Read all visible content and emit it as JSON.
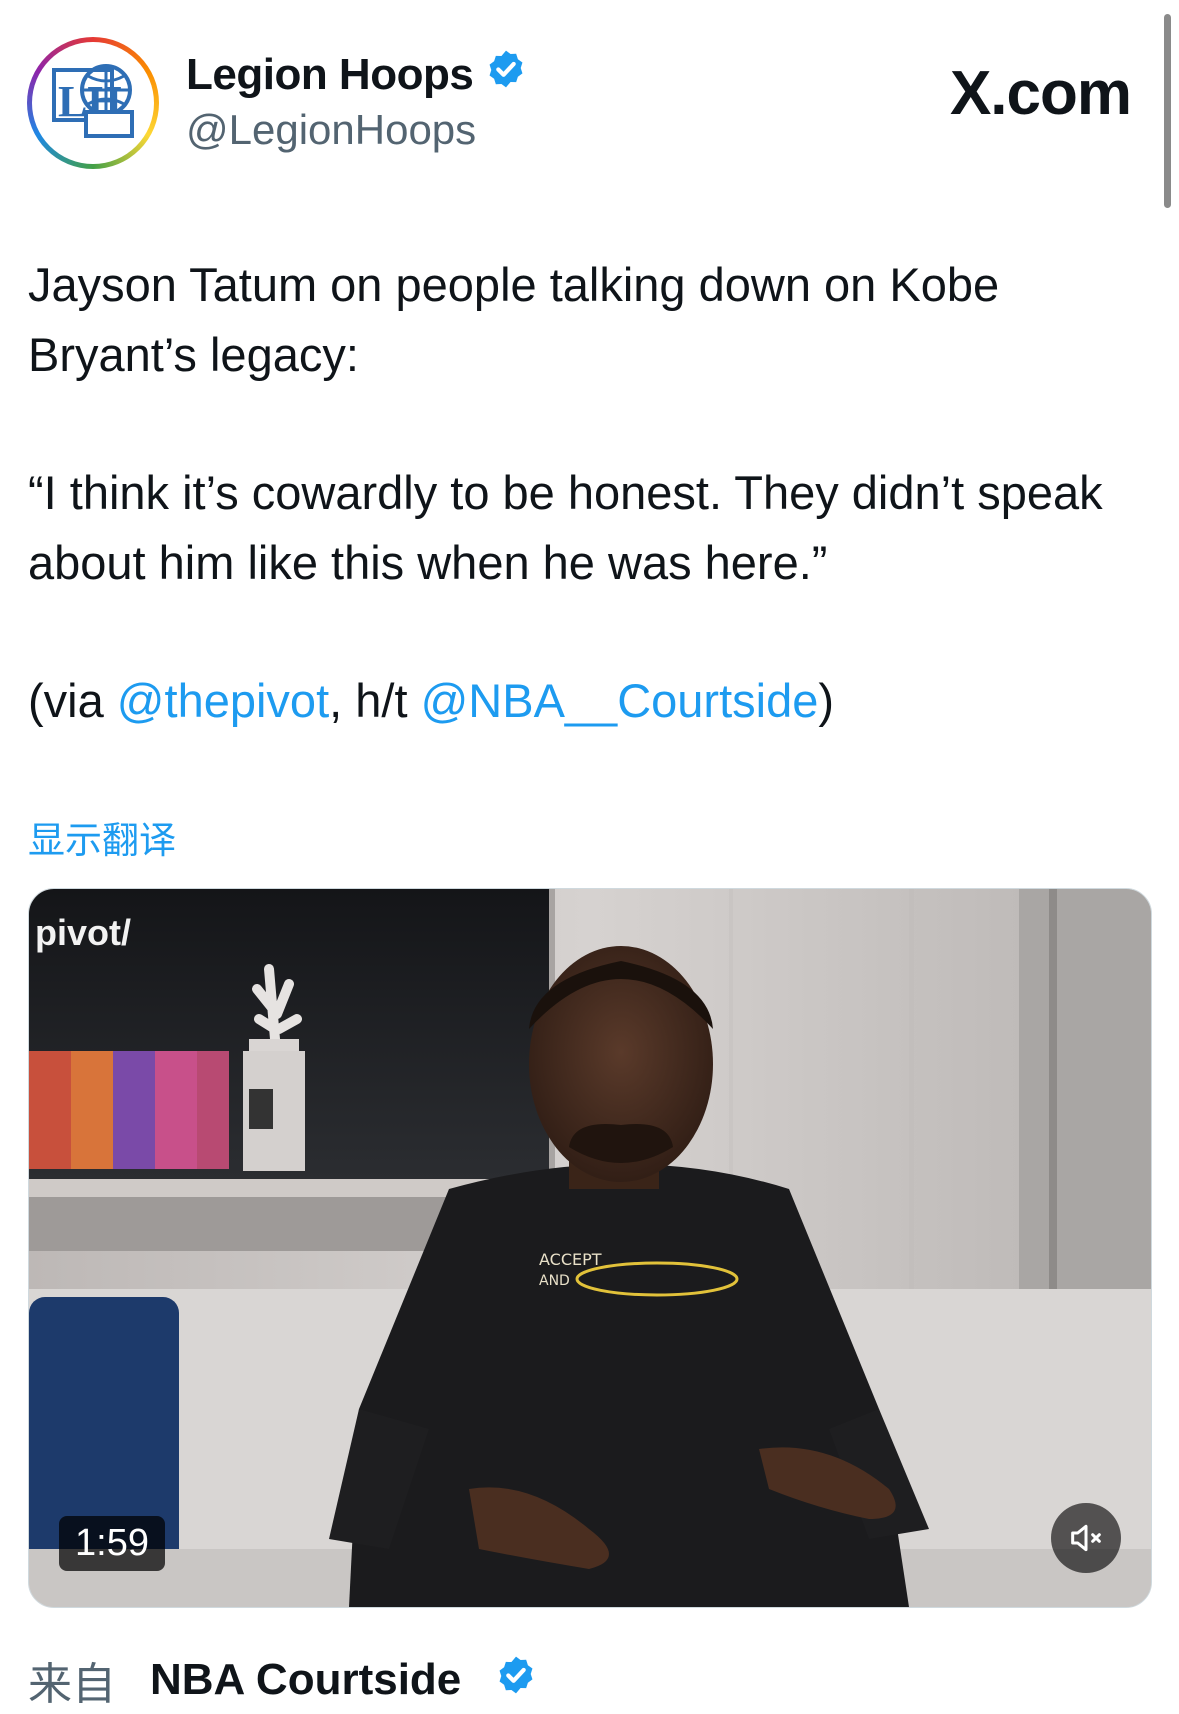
{
  "author": {
    "name": "Legion Hoops",
    "handle": "@LegionHoops",
    "avatar_text": "LH"
  },
  "site_label": "X.com",
  "tweet": {
    "line1": "Jayson Tatum on people talking down on Kobe Bryant’s legacy:",
    "quote": "“I think it’s cowardly to be honest. They didn’t speak about him like this when he was here.”",
    "via_prefix": "(via ",
    "via_mention": "@thepivot",
    "ht_text": ", h/t ",
    "ht_mention": "@NBA__Courtside",
    "closing": ")"
  },
  "translate_link": "显示翻译",
  "video": {
    "watermark": "pivot/",
    "duration": "1:59",
    "shirt_text": [
      "ACCEPT",
      "AND"
    ]
  },
  "source": {
    "from_label": "来自",
    "name": "NBA Courtside"
  },
  "colors": {
    "accent": "#1d9bf0",
    "text": "#0f1419",
    "muted": "#536471"
  },
  "icons": {
    "verified": "verified-badge-icon",
    "mute": "speaker-muted-icon"
  }
}
